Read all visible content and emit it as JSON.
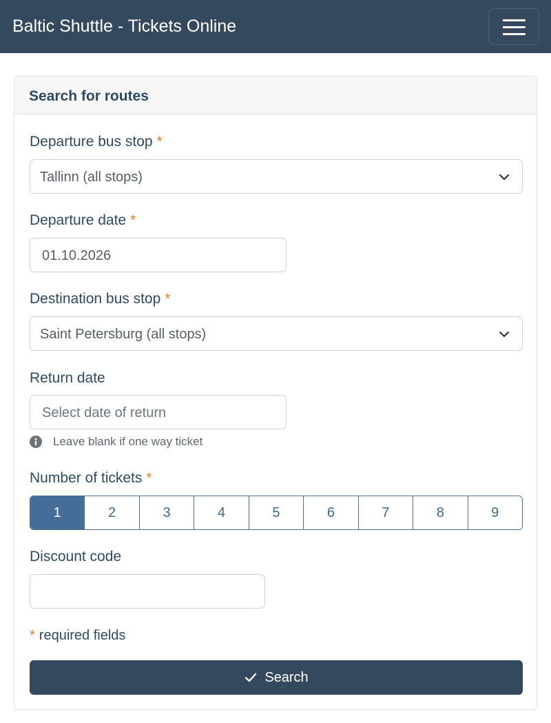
{
  "app": {
    "title": "Baltic Shuttle - Tickets Online"
  },
  "form": {
    "header": "Search for routes",
    "required_mark": "*",
    "departure_stop": {
      "label": "Departure bus stop",
      "value": "Tallinn (all stops)"
    },
    "departure_date": {
      "label": "Departure date",
      "value": "01.10.2026"
    },
    "destination_stop": {
      "label": "Destination bus stop",
      "value": "Saint Petersburg (all stops)"
    },
    "return_date": {
      "label": "Return date",
      "placeholder": "Select date of return",
      "hint": "Leave blank if one way ticket"
    },
    "tickets": {
      "label": "Number of tickets",
      "options": [
        "1",
        "2",
        "3",
        "4",
        "5",
        "6",
        "7",
        "8",
        "9"
      ],
      "selected": "1"
    },
    "discount": {
      "label": "Discount code",
      "value": ""
    },
    "required_note": "required fields",
    "search_label": "Search"
  },
  "colors": {
    "navbar": "#34495e",
    "accent": "#446d97",
    "required": "#e67e22"
  },
  "icons": {
    "menu": "hamburger-menu-icon",
    "dropdown": "chevron-down-icon",
    "info": "info-icon",
    "submit": "checkmark-icon"
  }
}
